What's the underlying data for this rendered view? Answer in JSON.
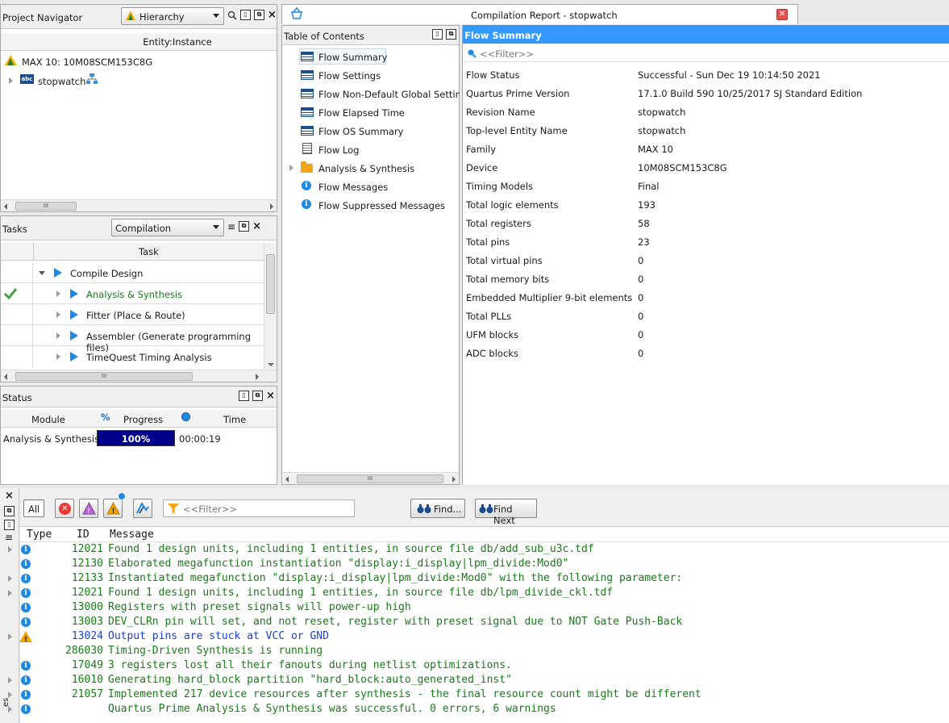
{
  "project_navigator": {
    "title": "Project Navigator",
    "view_select": "Hierarchy",
    "column_header": "Entity:Instance",
    "device": "MAX 10: 10M08SCM153C8G",
    "entity": "stopwatch"
  },
  "tasks": {
    "title": "Tasks",
    "flow_select": "Compilation",
    "column_header": "Task",
    "items": [
      {
        "label": "Compile Design",
        "done": false
      },
      {
        "label": "Analysis & Synthesis",
        "done": true
      },
      {
        "label": "Fitter (Place & Route)",
        "done": false
      },
      {
        "label": "Assembler (Generate programming files)",
        "done": false
      },
      {
        "label": "TimeQuest Timing Analysis",
        "done": false
      }
    ]
  },
  "status": {
    "title": "Status",
    "col_module": "Module",
    "col_progress_icon": "%",
    "col_progress": "Progress",
    "col_time": "Time",
    "row": {
      "module": "Analysis & Synthesis",
      "progress_label": "100%",
      "progress_value": 100,
      "time": "00:00:19"
    }
  },
  "report": {
    "tab_title": "Compilation Report - stopwatch",
    "toc_title": "Table of Contents",
    "toc_items": [
      {
        "label": "Flow Summary",
        "icon": "table-icon"
      },
      {
        "label": "Flow Settings",
        "icon": "table-icon"
      },
      {
        "label": "Flow Non-Default Global Settings",
        "icon": "table-icon"
      },
      {
        "label": "Flow Elapsed Time",
        "icon": "table-icon"
      },
      {
        "label": "Flow OS Summary",
        "icon": "table-icon"
      },
      {
        "label": "Flow Log",
        "icon": "log-icon"
      },
      {
        "label": "Analysis & Synthesis",
        "icon": "folder-icon"
      },
      {
        "label": "Flow Messages",
        "icon": "info-icon"
      },
      {
        "label": "Flow Suppressed Messages",
        "icon": "info-icon"
      }
    ],
    "section_title": "Flow Summary",
    "filter_placeholder": "<<Filter>>",
    "summary": [
      {
        "key": "Flow Status",
        "value": "Successful - Sun Dec 19 10:14:50 2021"
      },
      {
        "key": "Quartus Prime Version",
        "value": "17.1.0 Build 590 10/25/2017 SJ Standard Edition"
      },
      {
        "key": "Revision Name",
        "value": "stopwatch"
      },
      {
        "key": "Top-level Entity Name",
        "value": "stopwatch"
      },
      {
        "key": "Family",
        "value": "MAX 10"
      },
      {
        "key": "Device",
        "value": "10M08SCM153C8G"
      },
      {
        "key": "Timing Models",
        "value": "Final"
      },
      {
        "key": "Total logic elements",
        "value": "193"
      },
      {
        "key": "Total registers",
        "value": "58"
      },
      {
        "key": "Total pins",
        "value": "23"
      },
      {
        "key": "Total virtual pins",
        "value": "0"
      },
      {
        "key": "Total memory bits",
        "value": "0"
      },
      {
        "key": "Embedded Multiplier 9-bit elements",
        "value": "0"
      },
      {
        "key": "Total PLLs",
        "value": "0"
      },
      {
        "key": "UFM blocks",
        "value": "0"
      },
      {
        "key": "ADC blocks",
        "value": "0"
      }
    ]
  },
  "messages": {
    "all_label": "All",
    "filter_placeholder": "<<Filter>>",
    "find_label": "Find...",
    "find_next_label": "Find Next",
    "side_label": "es",
    "col_type": "Type",
    "col_id": "ID",
    "col_message": "Message",
    "rows": [
      {
        "type": "info",
        "expand": true,
        "id": "12021",
        "text": "Found 1 design units, including 1 entities, in source file db/add_sub_u3c.tdf"
      },
      {
        "type": "info",
        "expand": false,
        "id": "12130",
        "text": "Elaborated megafunction instantiation \"display:i_display|lpm_divide:Mod0\""
      },
      {
        "type": "info",
        "expand": true,
        "id": "12133",
        "text": "Instantiated megafunction \"display:i_display|lpm_divide:Mod0\" with the following parameter:"
      },
      {
        "type": "info",
        "expand": true,
        "id": "12021",
        "text": "Found 1 design units, including 1 entities, in source file db/lpm_divide_ckl.tdf"
      },
      {
        "type": "info",
        "expand": false,
        "id": "13000",
        "text": "Registers with preset signals will power-up high"
      },
      {
        "type": "info",
        "expand": false,
        "id": "13003",
        "text": "DEV_CLRn pin will set, and not reset, register with preset signal due to NOT Gate Push-Back"
      },
      {
        "type": "warning",
        "expand": true,
        "id": "13024",
        "text": "Output pins are stuck at VCC or GND"
      },
      {
        "type": "info",
        "expand": false,
        "id": "286030",
        "text": "Timing-Driven Synthesis is running"
      },
      {
        "type": "info",
        "expand": false,
        "id": "17049",
        "text": "3 registers lost all their fanouts during netlist optimizations."
      },
      {
        "type": "info",
        "expand": true,
        "id": "16010",
        "text": "Generating hard_block partition \"hard_block:auto_generated_inst\""
      },
      {
        "type": "info",
        "expand": true,
        "id": "21057",
        "text": "Implemented 217 device resources after synthesis - the final resource count might be different"
      },
      {
        "type": "info",
        "expand": true,
        "id": "",
        "text": "Quartus Prime Analysis & Synthesis was successful. 0 errors, 6 warnings"
      }
    ]
  },
  "colors": {
    "accent": "#3399ff",
    "info_text": "#1a7a1a",
    "warning_text": "#1a3fcc",
    "progress_fill": "#00008b"
  }
}
